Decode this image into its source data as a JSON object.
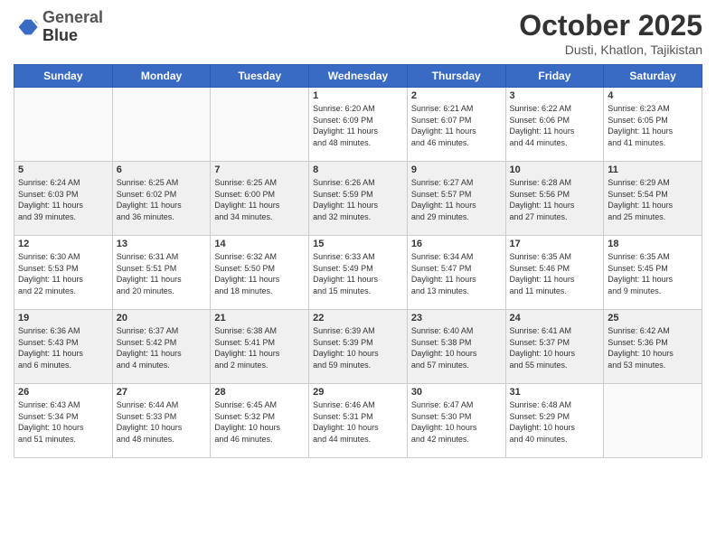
{
  "header": {
    "logo_line1": "General",
    "logo_line2": "Blue",
    "month_title": "October 2025",
    "location": "Dusti, Khatlon, Tajikistan"
  },
  "weekdays": [
    "Sunday",
    "Monday",
    "Tuesday",
    "Wednesday",
    "Thursday",
    "Friday",
    "Saturday"
  ],
  "weeks": [
    {
      "shaded": false,
      "days": [
        {
          "num": "",
          "info": ""
        },
        {
          "num": "",
          "info": ""
        },
        {
          "num": "",
          "info": ""
        },
        {
          "num": "1",
          "info": "Sunrise: 6:20 AM\nSunset: 6:09 PM\nDaylight: 11 hours\nand 48 minutes."
        },
        {
          "num": "2",
          "info": "Sunrise: 6:21 AM\nSunset: 6:07 PM\nDaylight: 11 hours\nand 46 minutes."
        },
        {
          "num": "3",
          "info": "Sunrise: 6:22 AM\nSunset: 6:06 PM\nDaylight: 11 hours\nand 44 minutes."
        },
        {
          "num": "4",
          "info": "Sunrise: 6:23 AM\nSunset: 6:05 PM\nDaylight: 11 hours\nand 41 minutes."
        }
      ]
    },
    {
      "shaded": true,
      "days": [
        {
          "num": "5",
          "info": "Sunrise: 6:24 AM\nSunset: 6:03 PM\nDaylight: 11 hours\nand 39 minutes."
        },
        {
          "num": "6",
          "info": "Sunrise: 6:25 AM\nSunset: 6:02 PM\nDaylight: 11 hours\nand 36 minutes."
        },
        {
          "num": "7",
          "info": "Sunrise: 6:25 AM\nSunset: 6:00 PM\nDaylight: 11 hours\nand 34 minutes."
        },
        {
          "num": "8",
          "info": "Sunrise: 6:26 AM\nSunset: 5:59 PM\nDaylight: 11 hours\nand 32 minutes."
        },
        {
          "num": "9",
          "info": "Sunrise: 6:27 AM\nSunset: 5:57 PM\nDaylight: 11 hours\nand 29 minutes."
        },
        {
          "num": "10",
          "info": "Sunrise: 6:28 AM\nSunset: 5:56 PM\nDaylight: 11 hours\nand 27 minutes."
        },
        {
          "num": "11",
          "info": "Sunrise: 6:29 AM\nSunset: 5:54 PM\nDaylight: 11 hours\nand 25 minutes."
        }
      ]
    },
    {
      "shaded": false,
      "days": [
        {
          "num": "12",
          "info": "Sunrise: 6:30 AM\nSunset: 5:53 PM\nDaylight: 11 hours\nand 22 minutes."
        },
        {
          "num": "13",
          "info": "Sunrise: 6:31 AM\nSunset: 5:51 PM\nDaylight: 11 hours\nand 20 minutes."
        },
        {
          "num": "14",
          "info": "Sunrise: 6:32 AM\nSunset: 5:50 PM\nDaylight: 11 hours\nand 18 minutes."
        },
        {
          "num": "15",
          "info": "Sunrise: 6:33 AM\nSunset: 5:49 PM\nDaylight: 11 hours\nand 15 minutes."
        },
        {
          "num": "16",
          "info": "Sunrise: 6:34 AM\nSunset: 5:47 PM\nDaylight: 11 hours\nand 13 minutes."
        },
        {
          "num": "17",
          "info": "Sunrise: 6:35 AM\nSunset: 5:46 PM\nDaylight: 11 hours\nand 11 minutes."
        },
        {
          "num": "18",
          "info": "Sunrise: 6:35 AM\nSunset: 5:45 PM\nDaylight: 11 hours\nand 9 minutes."
        }
      ]
    },
    {
      "shaded": true,
      "days": [
        {
          "num": "19",
          "info": "Sunrise: 6:36 AM\nSunset: 5:43 PM\nDaylight: 11 hours\nand 6 minutes."
        },
        {
          "num": "20",
          "info": "Sunrise: 6:37 AM\nSunset: 5:42 PM\nDaylight: 11 hours\nand 4 minutes."
        },
        {
          "num": "21",
          "info": "Sunrise: 6:38 AM\nSunset: 5:41 PM\nDaylight: 11 hours\nand 2 minutes."
        },
        {
          "num": "22",
          "info": "Sunrise: 6:39 AM\nSunset: 5:39 PM\nDaylight: 10 hours\nand 59 minutes."
        },
        {
          "num": "23",
          "info": "Sunrise: 6:40 AM\nSunset: 5:38 PM\nDaylight: 10 hours\nand 57 minutes."
        },
        {
          "num": "24",
          "info": "Sunrise: 6:41 AM\nSunset: 5:37 PM\nDaylight: 10 hours\nand 55 minutes."
        },
        {
          "num": "25",
          "info": "Sunrise: 6:42 AM\nSunset: 5:36 PM\nDaylight: 10 hours\nand 53 minutes."
        }
      ]
    },
    {
      "shaded": false,
      "days": [
        {
          "num": "26",
          "info": "Sunrise: 6:43 AM\nSunset: 5:34 PM\nDaylight: 10 hours\nand 51 minutes."
        },
        {
          "num": "27",
          "info": "Sunrise: 6:44 AM\nSunset: 5:33 PM\nDaylight: 10 hours\nand 48 minutes."
        },
        {
          "num": "28",
          "info": "Sunrise: 6:45 AM\nSunset: 5:32 PM\nDaylight: 10 hours\nand 46 minutes."
        },
        {
          "num": "29",
          "info": "Sunrise: 6:46 AM\nSunset: 5:31 PM\nDaylight: 10 hours\nand 44 minutes."
        },
        {
          "num": "30",
          "info": "Sunrise: 6:47 AM\nSunset: 5:30 PM\nDaylight: 10 hours\nand 42 minutes."
        },
        {
          "num": "31",
          "info": "Sunrise: 6:48 AM\nSunset: 5:29 PM\nDaylight: 10 hours\nand 40 minutes."
        },
        {
          "num": "",
          "info": ""
        }
      ]
    }
  ]
}
